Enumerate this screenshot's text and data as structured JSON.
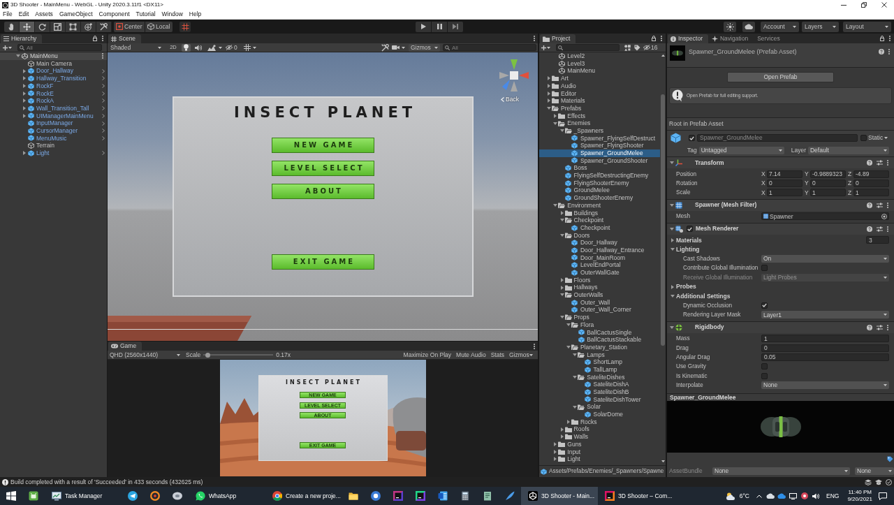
{
  "window": {
    "title": "3D Shooter - MainMenu - WebGL - Unity 2020.3.11f1 <DX11>"
  },
  "menu_bar": [
    "File",
    "Edit",
    "Assets",
    "GameObject",
    "Component",
    "Tutorial",
    "Window",
    "Help"
  ],
  "toolbar": {
    "tools": [
      {
        "kind": "hand",
        "selected": false
      },
      {
        "kind": "move",
        "selected": true
      },
      {
        "kind": "rotate",
        "selected": false
      },
      {
        "kind": "scale",
        "selected": false
      },
      {
        "kind": "rect",
        "selected": false
      },
      {
        "kind": "transform",
        "selected": false
      },
      {
        "kind": "custom",
        "selected": false
      }
    ],
    "pivot": "Center",
    "space": "Local",
    "account": "Account",
    "layers": "Layers",
    "layout": "Layout"
  },
  "hierarchy": {
    "title": "Hierarchy",
    "search": {
      "placeholder": "All"
    },
    "scene": {
      "label": "MainMenu",
      "expanded": true,
      "children": [
        {
          "label": "Main Camera",
          "kind": "gameobject",
          "selected": false
        },
        {
          "label": "Door_Hallway",
          "kind": "prefab",
          "expanded": false,
          "selected": false
        },
        {
          "label": "Hallway_Transition",
          "kind": "prefab",
          "expanded": false,
          "selected": false
        },
        {
          "label": "RockF",
          "kind": "prefab",
          "expanded": false,
          "selected": false
        },
        {
          "label": "RockE",
          "kind": "prefab",
          "expanded": false,
          "selected": false
        },
        {
          "label": "RockA",
          "kind": "prefab",
          "expanded": false,
          "selected": false
        },
        {
          "label": "Wall_Transition_Tall",
          "kind": "prefab",
          "expanded": false,
          "selected": false
        },
        {
          "label": "UIManagerMainMenu",
          "kind": "prefab",
          "expanded": false,
          "selected": false
        },
        {
          "label": "InputManager",
          "kind": "prefab",
          "selected": false
        },
        {
          "label": "CursorManager",
          "kind": "prefab",
          "selected": false
        },
        {
          "label": "MenuMusic",
          "kind": "prefab",
          "selected": false
        },
        {
          "label": "Terrain",
          "kind": "gameobject",
          "selected": false
        },
        {
          "label": "Light",
          "kind": "prefab",
          "expanded": false,
          "selected": false
        }
      ]
    }
  },
  "scene": {
    "title": "Scene",
    "shading": "Shaded",
    "view_2d": "2D",
    "toggles": [
      {
        "kind": "lighting",
        "on": true
      },
      {
        "kind": "audio",
        "on": false
      },
      {
        "kind": "effects",
        "on": false
      }
    ],
    "hidden_count": "0",
    "gizmos": "Gizmos",
    "search": {
      "placeholder": "All"
    },
    "orientation_label": "Back",
    "canvas": {
      "title": "INSECT PLANET",
      "buttons": [
        "NEW GAME",
        "LEVEL SELECT",
        "ABOUT",
        "EXIT GAME"
      ]
    }
  },
  "game": {
    "title": "Game",
    "display": "QHD (2560x1440)",
    "scale_label": "Scale",
    "scale": {
      "level": 0.03
    },
    "scale_value": "0.17x",
    "toggles": [
      {
        "label": "Maximize On Play",
        "on": false
      },
      {
        "label": "Mute Audio",
        "on": false
      },
      {
        "label": "Stats",
        "on": false
      }
    ],
    "gizmos": "Gizmos",
    "canvas": {
      "title": "INSECT PLANET",
      "buttons": [
        "NEW GAME",
        "LEVEL SELECT",
        "ABOUT",
        "EXIT GAME"
      ]
    }
  },
  "project": {
    "title": "Project",
    "hidden_count": "16",
    "scrolled_folder_items": [
      {
        "label": "Level2",
        "kind": "scene",
        "selected": false
      },
      {
        "label": "Level3",
        "kind": "scene",
        "selected": false
      },
      {
        "label": "MainMenu",
        "kind": "scene",
        "selected": false
      }
    ],
    "tree": [
      {
        "label": "Art",
        "kind": "folder",
        "expanded": false,
        "selected": false
      },
      {
        "label": "Audio",
        "kind": "folder",
        "expanded": false,
        "selected": false
      },
      {
        "label": "Editor",
        "kind": "folder",
        "expanded": false,
        "selected": false
      },
      {
        "label": "Materials",
        "kind": "folder",
        "expanded": false,
        "selected": false
      },
      {
        "label": "Prefabs",
        "kind": "folder",
        "expanded": true,
        "selected": false,
        "children": [
          {
            "label": "Effects",
            "kind": "folder",
            "expanded": false,
            "selected": false
          },
          {
            "label": "Enemies",
            "kind": "folder",
            "expanded": true,
            "selected": false,
            "children": [
              {
                "label": "_Spawners",
                "kind": "folder",
                "expanded": true,
                "selected": false,
                "children": [
                  {
                    "label": "Spawner_FlyingSelfDestruct",
                    "kind": "prefab",
                    "selected": false
                  },
                  {
                    "label": "Spawner_FlyingShooter",
                    "kind": "prefab",
                    "selected": false
                  },
                  {
                    "label": "Spawner_GroundMelee",
                    "kind": "prefab",
                    "selected": true
                  },
                  {
                    "label": "Spawner_GroundShooter",
                    "kind": "prefab",
                    "selected": false
                  }
                ]
              },
              {
                "label": "Boss",
                "kind": "prefab",
                "selected": false
              },
              {
                "label": "FlyingSelfDestructingEnemy",
                "kind": "prefab",
                "selected": false
              },
              {
                "label": "FlyingShooterEnemy",
                "kind": "prefab",
                "selected": false
              },
              {
                "label": "GroundMelee",
                "kind": "prefab",
                "selected": false
              },
              {
                "label": "GroundShooterEnemy",
                "kind": "prefab",
                "selected": false
              }
            ]
          },
          {
            "label": "Environment",
            "kind": "folder",
            "expanded": true,
            "selected": false,
            "children": [
              {
                "label": "Buildings",
                "kind": "folder",
                "expanded": false,
                "selected": false
              },
              {
                "label": "Checkpoint",
                "kind": "folder",
                "expanded": true,
                "selected": false,
                "children": [
                  {
                    "label": "Checkpoint",
                    "kind": "prefab",
                    "selected": false
                  }
                ]
              },
              {
                "label": "Doors",
                "kind": "folder",
                "expanded": true,
                "selected": false,
                "children": [
                  {
                    "label": "Door_Hallway",
                    "kind": "prefab",
                    "selected": false
                  },
                  {
                    "label": "Door_Hallway_Entrance",
                    "kind": "prefab",
                    "selected": false
                  },
                  {
                    "label": "Door_MainRoom",
                    "kind": "prefab",
                    "selected": false
                  },
                  {
                    "label": "LevelEndPortal",
                    "kind": "prefab",
                    "selected": false
                  },
                  {
                    "label": "OuterWallGate",
                    "kind": "prefab",
                    "selected": false
                  }
                ]
              },
              {
                "label": "Floors",
                "kind": "folder",
                "expanded": false,
                "selected": false
              },
              {
                "label": "Hallways",
                "kind": "folder",
                "expanded": false,
                "selected": false
              },
              {
                "label": "OuterWalls",
                "kind": "folder",
                "expanded": true,
                "selected": false,
                "children": [
                  {
                    "label": "Outer_Wall",
                    "kind": "prefab",
                    "selected": false
                  },
                  {
                    "label": "Outer_Wall_Corner",
                    "kind": "prefab",
                    "selected": false
                  }
                ]
              },
              {
                "label": "Props",
                "kind": "folder",
                "expanded": true,
                "selected": false,
                "children": [
                  {
                    "label": "Flora",
                    "kind": "folder",
                    "expanded": true,
                    "selected": false,
                    "children": [
                      {
                        "label": "BallCactusSingle",
                        "kind": "prefab",
                        "selected": false
                      },
                      {
                        "label": "BallCactusStackable",
                        "kind": "prefab",
                        "selected": false
                      }
                    ]
                  },
                  {
                    "label": "Planetary_Station",
                    "kind": "folder",
                    "expanded": true,
                    "selected": false,
                    "children": [
                      {
                        "label": "Lamps",
                        "kind": "folder",
                        "expanded": true,
                        "selected": false,
                        "children": [
                          {
                            "label": "ShortLamp",
                            "kind": "prefab",
                            "selected": false
                          },
                          {
                            "label": "TallLamp",
                            "kind": "prefab",
                            "selected": false
                          }
                        ]
                      },
                      {
                        "label": "SateliteDishes",
                        "kind": "folder",
                        "expanded": true,
                        "selected": false,
                        "children": [
                          {
                            "label": "SateliteDishA",
                            "kind": "prefab",
                            "selected": false
                          },
                          {
                            "label": "SateliteDishB",
                            "kind": "prefab",
                            "selected": false
                          },
                          {
                            "label": "SateliteDishTower",
                            "kind": "prefab",
                            "selected": false
                          }
                        ]
                      },
                      {
                        "label": "Solar",
                        "kind": "folder",
                        "expanded": true,
                        "selected": false,
                        "children": [
                          {
                            "label": "SolarDome",
                            "kind": "prefab",
                            "selected": false
                          }
                        ]
                      }
                    ]
                  },
                  {
                    "label": "Rocks",
                    "kind": "folder",
                    "expanded": false,
                    "selected": false
                  }
                ]
              },
              {
                "label": "Roofs",
                "kind": "folder",
                "expanded": false,
                "selected": false
              },
              {
                "label": "Walls",
                "kind": "folder",
                "expanded": false,
                "selected": false
              }
            ]
          },
          {
            "label": "Guns",
            "kind": "folder",
            "expanded": false,
            "selected": false
          },
          {
            "label": "Input",
            "kind": "folder",
            "expanded": false,
            "selected": false
          },
          {
            "label": "Light",
            "kind": "folder",
            "expanded": false,
            "selected": false
          }
        ]
      }
    ],
    "path": "Assets/Prefabs/Enemies/_Spawners/Spawne"
  },
  "inspector": {
    "tabs": [
      {
        "label": "Inspector",
        "kind": "inspector",
        "selected": true
      },
      {
        "label": "Navigation",
        "kind": "navigation",
        "selected": false
      },
      {
        "label": "Services",
        "kind": "services",
        "selected": false
      }
    ],
    "asset_title": "Spawner_GroundMelee (Prefab Asset)",
    "open_prefab_button": "Open Prefab",
    "info_message": "Open Prefab for full editing support.",
    "root_label": "Root in Prefab Asset",
    "game_object": {
      "active": true,
      "name": "Spawner_GroundMelee",
      "static": false,
      "static_label": "Static",
      "tag_label": "Tag",
      "tag": "Untagged",
      "layer_label": "Layer",
      "layer": "Default"
    },
    "components": [
      {
        "kind": "transform",
        "title": "Transform",
        "expanded": true,
        "fields": [
          {
            "kind": "vector3",
            "label": "Position",
            "values": [
              {
                "axis": "X",
                "value": "7.14"
              },
              {
                "axis": "Y",
                "value": "-0.9889323"
              },
              {
                "axis": "Z",
                "value": "-4.89"
              }
            ]
          },
          {
            "kind": "vector3",
            "label": "Rotation",
            "values": [
              {
                "axis": "X",
                "value": "0"
              },
              {
                "axis": "Y",
                "value": "0"
              },
              {
                "axis": "Z",
                "value": "0"
              }
            ]
          },
          {
            "kind": "vector3",
            "label": "Scale",
            "values": [
              {
                "axis": "X",
                "value": "1"
              },
              {
                "axis": "Y",
                "value": "1"
              },
              {
                "axis": "Z",
                "value": "1"
              }
            ]
          }
        ]
      },
      {
        "kind": "mesh_filter",
        "title": "Spawner (Mesh Filter)",
        "expanded": true,
        "fields": [
          {
            "kind": "object",
            "label": "Mesh",
            "value": "Spawner"
          }
        ]
      },
      {
        "kind": "mesh_renderer",
        "title": "Mesh Renderer",
        "expanded": true,
        "enabled": true,
        "fields": [
          {
            "kind": "foldout",
            "label": "Materials",
            "expanded": false,
            "value": "3"
          },
          {
            "kind": "foldout",
            "label": "Lighting",
            "expanded": true,
            "children": [
              {
                "kind": "dropdown",
                "label": "Cast Shadows",
                "value": "On",
                "disabled": false
              },
              {
                "kind": "checkbox",
                "label": "Contribute Global Illumination",
                "checked": false
              },
              {
                "kind": "dropdown",
                "label": "Receive Global Illumination",
                "value": "Light Probes",
                "disabled": true
              }
            ]
          },
          {
            "kind": "foldout",
            "label": "Probes",
            "expanded": false
          },
          {
            "kind": "foldout",
            "label": "Additional Settings",
            "expanded": true,
            "children": [
              {
                "kind": "checkbox",
                "label": "Dynamic Occlusion",
                "checked": true
              },
              {
                "kind": "dropdown",
                "label": "Rendering Layer Mask",
                "value": "Layer1",
                "disabled": false
              }
            ]
          }
        ]
      },
      {
        "kind": "rigidbody",
        "title": "Rigidbody",
        "expanded": true,
        "fields": [
          {
            "kind": "number",
            "label": "Mass",
            "value": "1"
          },
          {
            "kind": "number",
            "label": "Drag",
            "value": "0"
          },
          {
            "kind": "number",
            "label": "Angular Drag",
            "value": "0.05"
          },
          {
            "kind": "checkbox",
            "label": "Use Gravity",
            "checked": false
          },
          {
            "kind": "checkbox",
            "label": "Is Kinematic",
            "checked": false
          },
          {
            "kind": "dropdown",
            "label": "Interpolate",
            "value": "None",
            "disabled": false
          }
        ]
      }
    ],
    "preview_title": "Spawner_GroundMelee",
    "asset_bundle": {
      "label": "AssetBundle",
      "name": "None",
      "variant": "None"
    }
  },
  "status_bar": {
    "message": "Build completed with a result of 'Succeeded' in 433 seconds (432625 ms)"
  },
  "taskbar": {
    "apps": [
      {
        "kind": "start",
        "selected": false
      },
      {
        "kind": "robot",
        "selected": false
      },
      {
        "kind": "monitor",
        "label": "Task Manager",
        "selected": false
      },
      {
        "kind": "plane",
        "selected": false
      },
      {
        "kind": "ring",
        "selected": false
      },
      {
        "kind": "disc",
        "selected": false
      },
      {
        "kind": "bubble",
        "label": "WhatsApp",
        "selected": false
      },
      {
        "kind": "browser",
        "label": "Create a new proje...",
        "selected": false
      },
      {
        "kind": "folder",
        "selected": false
      },
      {
        "kind": "badge",
        "selected": false
      },
      {
        "kind": "tile",
        "selected": false
      },
      {
        "kind": "tile2",
        "selected": false
      },
      {
        "kind": "document",
        "selected": false
      },
      {
        "kind": "calculator",
        "selected": false
      },
      {
        "kind": "notebook",
        "selected": false
      },
      {
        "kind": "feather",
        "selected": false
      },
      {
        "kind": "cube",
        "label": "3D Shooter - Main...",
        "selected": true
      },
      {
        "kind": "tile3",
        "label": "3D Shooter – Com...",
        "selected": false
      }
    ],
    "tray": {
      "weather": "6°C",
      "language": "ENG",
      "time": "11:40 PM",
      "date": "9/20/2021"
    }
  }
}
